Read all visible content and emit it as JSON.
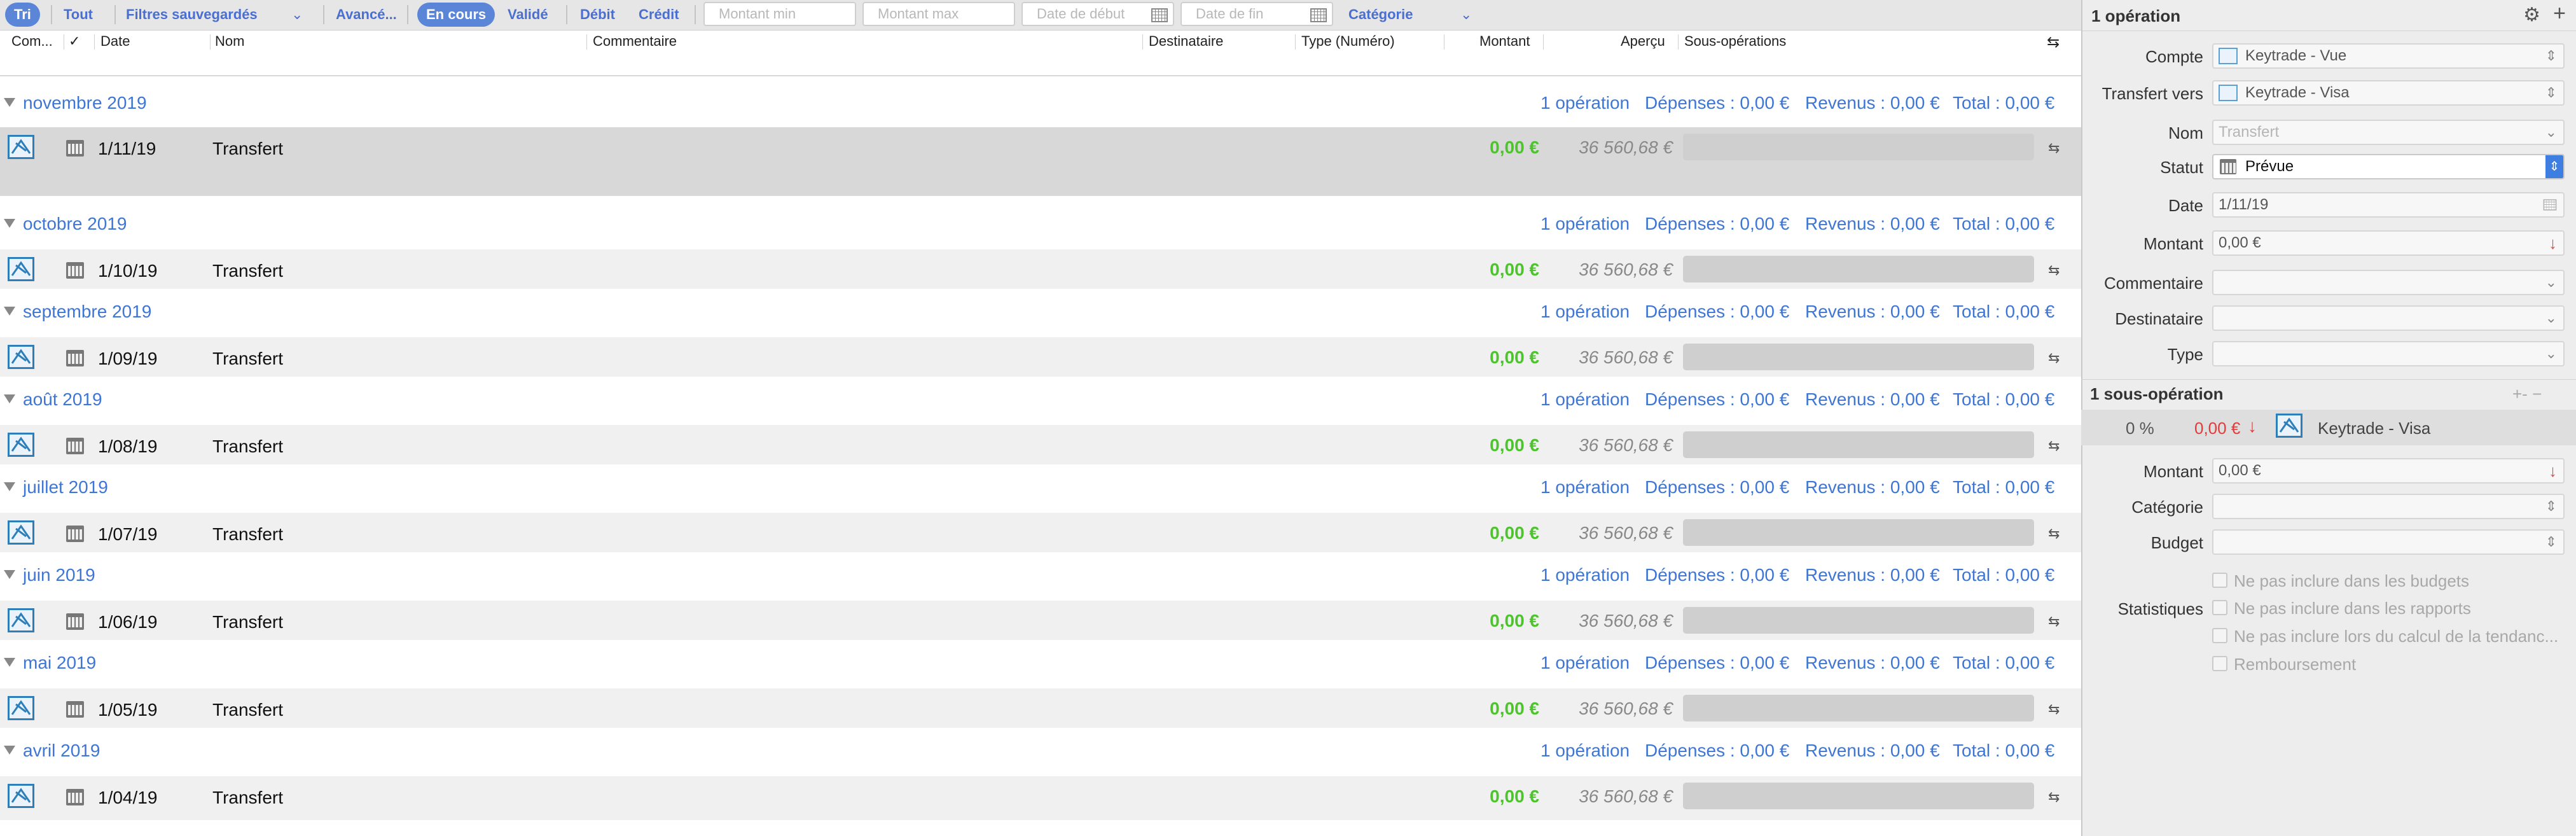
{
  "filterbar": {
    "tri": "Tri",
    "tout": "Tout",
    "saved_filters": "Filtres sauvegardés",
    "advanced": "Avancé...",
    "en_cours": "En cours",
    "valide": "Validé",
    "debit": "Débit",
    "credit": "Crédit",
    "montant_min": "Montant min",
    "montant_max": "Montant max",
    "date_debut": "Date de début",
    "date_fin": "Date de fin",
    "categorie": "Catégorie"
  },
  "columns": {
    "com": "Com...",
    "check": "✓",
    "date": "Date",
    "nom": "Nom",
    "commentaire": "Commentaire",
    "destinataire": "Destinataire",
    "type": "Type (Numéro)",
    "montant": "Montant",
    "apercu": "Aperçu",
    "sous_operations": "Sous-opérations"
  },
  "months": [
    {
      "title": "novembre 2019",
      "count": "1 opération",
      "depenses": "Dépenses : 0,00 €",
      "revenus": "Revenus : 0,00 €",
      "total": "Total : 0,00 €",
      "tx": {
        "date": "1/11/19",
        "name": "Transfert",
        "amount": "0,00 €",
        "balance": "36 560,68 €"
      }
    },
    {
      "title": "octobre 2019",
      "count": "1 opération",
      "depenses": "Dépenses : 0,00 €",
      "revenus": "Revenus : 0,00 €",
      "total": "Total : 0,00 €",
      "tx": {
        "date": "1/10/19",
        "name": "Transfert",
        "amount": "0,00 €",
        "balance": "36 560,68 €"
      }
    },
    {
      "title": "septembre 2019",
      "count": "1 opération",
      "depenses": "Dépenses : 0,00 €",
      "revenus": "Revenus : 0,00 €",
      "total": "Total : 0,00 €",
      "tx": {
        "date": "1/09/19",
        "name": "Transfert",
        "amount": "0,00 €",
        "balance": "36 560,68 €"
      }
    },
    {
      "title": "août 2019",
      "count": "1 opération",
      "depenses": "Dépenses : 0,00 €",
      "revenus": "Revenus : 0,00 €",
      "total": "Total : 0,00 €",
      "tx": {
        "date": "1/08/19",
        "name": "Transfert",
        "amount": "0,00 €",
        "balance": "36 560,68 €"
      }
    },
    {
      "title": "juillet 2019",
      "count": "1 opération",
      "depenses": "Dépenses : 0,00 €",
      "revenus": "Revenus : 0,00 €",
      "total": "Total : 0,00 €",
      "tx": {
        "date": "1/07/19",
        "name": "Transfert",
        "amount": "0,00 €",
        "balance": "36 560,68 €"
      }
    },
    {
      "title": "juin 2019",
      "count": "1 opération",
      "depenses": "Dépenses : 0,00 €",
      "revenus": "Revenus : 0,00 €",
      "total": "Total : 0,00 €",
      "tx": {
        "date": "1/06/19",
        "name": "Transfert",
        "amount": "0,00 €",
        "balance": "36 560,68 €"
      }
    },
    {
      "title": "mai 2019",
      "count": "1 opération",
      "depenses": "Dépenses : 0,00 €",
      "revenus": "Revenus : 0,00 €",
      "total": "Total : 0,00 €",
      "tx": {
        "date": "1/05/19",
        "name": "Transfert",
        "amount": "0,00 €",
        "balance": "36 560,68 €"
      }
    },
    {
      "title": "avril 2019",
      "count": "1 opération",
      "depenses": "Dépenses : 0,00 €",
      "revenus": "Revenus : 0,00 €",
      "total": "Total : 0,00 €",
      "tx": {
        "date": "1/04/19",
        "name": "Transfert",
        "amount": "0,00 €",
        "balance": "36 560,68 €"
      }
    }
  ],
  "inspector": {
    "title": "1 opération",
    "labels": {
      "compte": "Compte",
      "transfert_vers": "Transfert vers",
      "nom": "Nom",
      "statut": "Statut",
      "date": "Date",
      "montant": "Montant",
      "commentaire": "Commentaire",
      "destinataire": "Destinataire",
      "type": "Type"
    },
    "values": {
      "compte": "Keytrade - Vue",
      "transfert_vers": "Keytrade - Visa",
      "nom_placeholder": "Transfert",
      "statut": "Prévue",
      "date": "1/11/19",
      "montant": "0,00 €"
    },
    "subops": {
      "title": "1 sous-opération",
      "controls": "+- −",
      "percent": "0 %",
      "amount": "0,00 €",
      "account": "Keytrade - Visa",
      "labels": {
        "montant": "Montant",
        "categorie": "Catégorie",
        "budget": "Budget",
        "statistiques": "Statistiques"
      },
      "montant_value": "0,00 €",
      "checkboxes": [
        "Ne pas inclure dans les budgets",
        "Ne pas inclure dans les rapports",
        "Ne pas inclure lors du calcul de la tendanc...",
        "Remboursement"
      ]
    }
  }
}
